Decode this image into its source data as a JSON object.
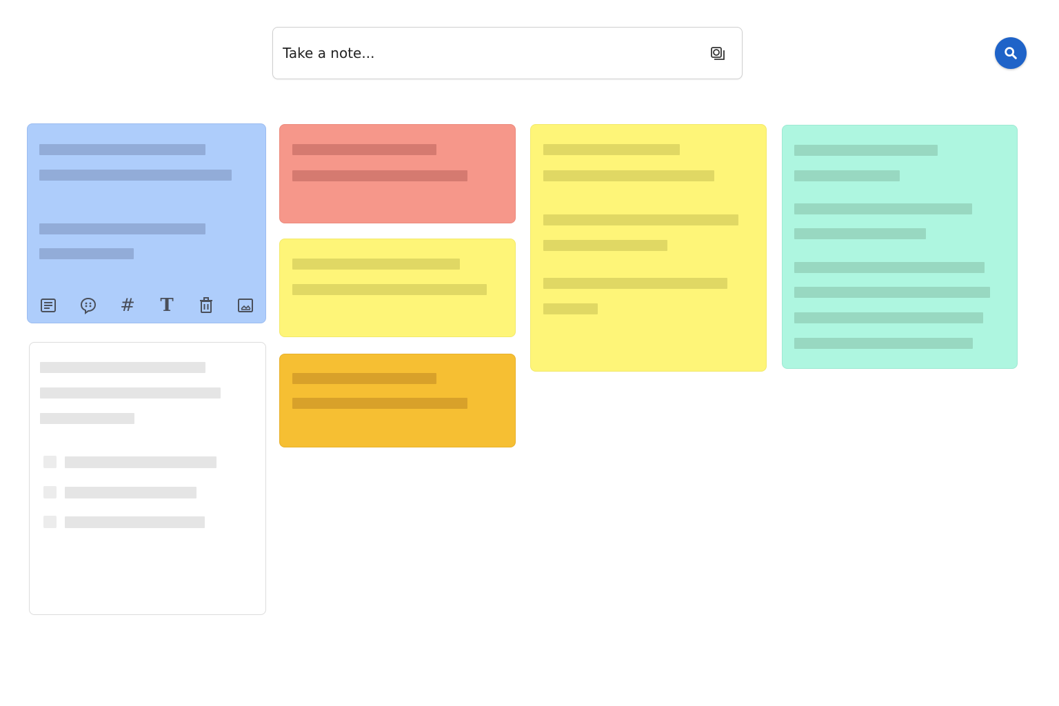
{
  "note_bar": {
    "placeholder": "Take a note...",
    "image_icon": "image-stack-icon"
  },
  "search": {
    "icon": "search-icon",
    "color": "#1f63c8"
  },
  "card_toolbar": {
    "icons": [
      "note-icon",
      "emoji-icon",
      "hashtag-icon",
      "text-format-icon",
      "trash-icon",
      "image-icon"
    ],
    "hashtag_glyph": "#",
    "text_glyph": "T"
  },
  "cards": [
    {
      "color": "#aecdfb",
      "name": "blue"
    },
    {
      "color": "#f6978a",
      "name": "red"
    },
    {
      "color": "#fef578",
      "name": "yellow"
    },
    {
      "color": "#f6bf33",
      "name": "amber"
    },
    {
      "color": "#fef578",
      "name": "yellow"
    },
    {
      "color": "#aef6e0",
      "name": "mint"
    },
    {
      "color": "#ffffff",
      "name": "white-checklist"
    }
  ]
}
